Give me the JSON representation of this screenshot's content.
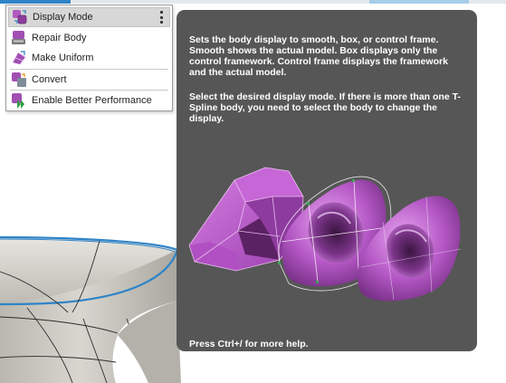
{
  "menu": {
    "items": [
      {
        "label": "Display Mode",
        "icon": "display-mode-icon",
        "selected": true
      },
      {
        "label": "Repair Body",
        "icon": "repair-body-icon"
      },
      {
        "label": "Make Uniform",
        "icon": "make-uniform-icon"
      },
      {
        "label": "Convert",
        "icon": "convert-icon"
      },
      {
        "label": "Enable Better Performance",
        "icon": "better-performance-icon"
      }
    ],
    "more_options_icon": "kebab-menu-icon"
  },
  "tooltip": {
    "paragraph1": "Sets the body display to smooth, box, or control frame. Smooth shows the actual model. Box displays only the control framework. Control frame displays the framework and the actual model.",
    "paragraph2": "Select the desired display mode. If there is more than one T-Spline body, you need to select the body to change the display.",
    "footer": "Press Ctrl+/ for more help."
  },
  "colors": {
    "tooltip_bg": "#565656",
    "tspline_purple": "#a24fb3",
    "selection_blue": "#2f84c8",
    "model_gray": "#c9c7bf"
  }
}
